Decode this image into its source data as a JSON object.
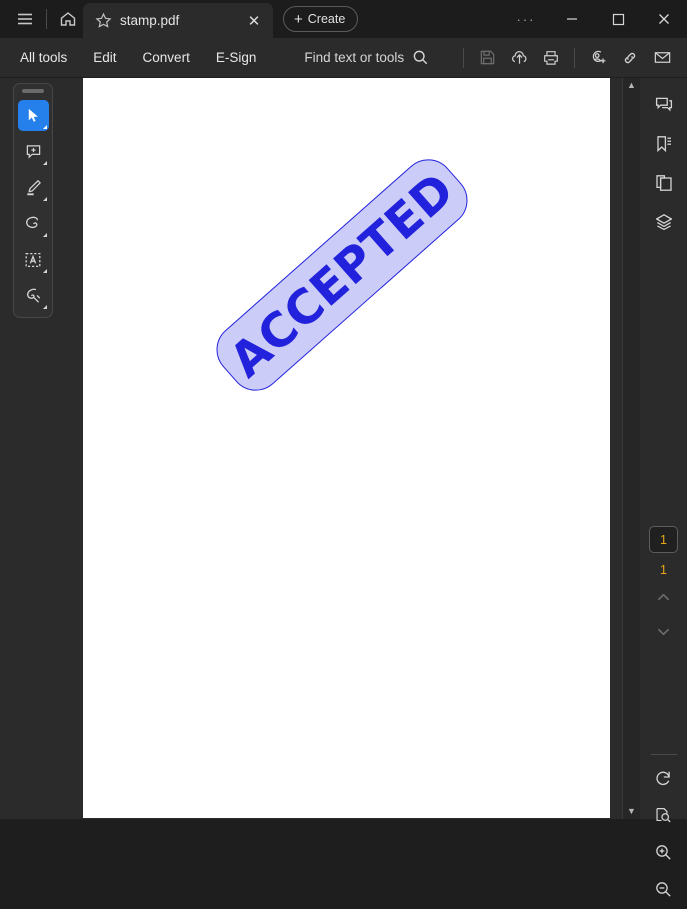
{
  "window": {
    "menu_icon": "hamburger-menu-icon",
    "home_icon": "home-icon",
    "more_label": "···",
    "minimize_label": "—",
    "maximize_label": "□",
    "close_label": "✕"
  },
  "tab": {
    "title": "stamp.pdf",
    "star_icon": "star-icon",
    "close_label": "✕"
  },
  "create": {
    "plus": "+",
    "label": "Create"
  },
  "toolbar": {
    "items": [
      {
        "label": "All tools"
      },
      {
        "label": "Edit"
      },
      {
        "label": "Convert"
      },
      {
        "label": "E-Sign"
      }
    ],
    "find_label": "Find text or tools",
    "icons": [
      {
        "name": "save-icon",
        "enabled": false
      },
      {
        "name": "upload-cloud-icon",
        "enabled": true
      },
      {
        "name": "print-icon",
        "enabled": true
      },
      {
        "name": "share-add-person-icon",
        "enabled": true
      },
      {
        "name": "link-icon",
        "enabled": true
      },
      {
        "name": "email-icon",
        "enabled": true
      }
    ]
  },
  "quick_tools": {
    "grip": "drag-handle",
    "items": [
      {
        "name": "select-cursor-tool",
        "active": true
      },
      {
        "name": "add-comment-tool",
        "active": false
      },
      {
        "name": "highlight-tool",
        "active": false
      },
      {
        "name": "draw-freehand-tool",
        "active": false
      },
      {
        "name": "text-select-tool",
        "active": false
      },
      {
        "name": "stamp-signature-tool",
        "active": false
      }
    ]
  },
  "document": {
    "stamp_text": "ACCEPTED",
    "stamp_fill": "#ccccf8",
    "stamp_stroke": "#2222dd",
    "stamp_text_color": "#2222dd",
    "stamp_rotation_deg": -41.5,
    "page_background": "#ffffff"
  },
  "right_rail": {
    "panels": [
      {
        "name": "comments-panel-icon"
      },
      {
        "name": "bookmarks-panel-icon"
      },
      {
        "name": "page-thumbnails-panel-icon"
      },
      {
        "name": "layers-panel-icon"
      }
    ],
    "page_number": "1",
    "page_total": "1",
    "prev_page_label": "⌃",
    "next_page_label": "⌄",
    "zoom_tools": [
      {
        "name": "rotate-clockwise-icon"
      },
      {
        "name": "fit-page-zoom-icon"
      },
      {
        "name": "zoom-in-icon"
      },
      {
        "name": "zoom-out-icon"
      }
    ]
  },
  "scrollbar": {
    "up_label": "▲",
    "down_label": "▼"
  }
}
